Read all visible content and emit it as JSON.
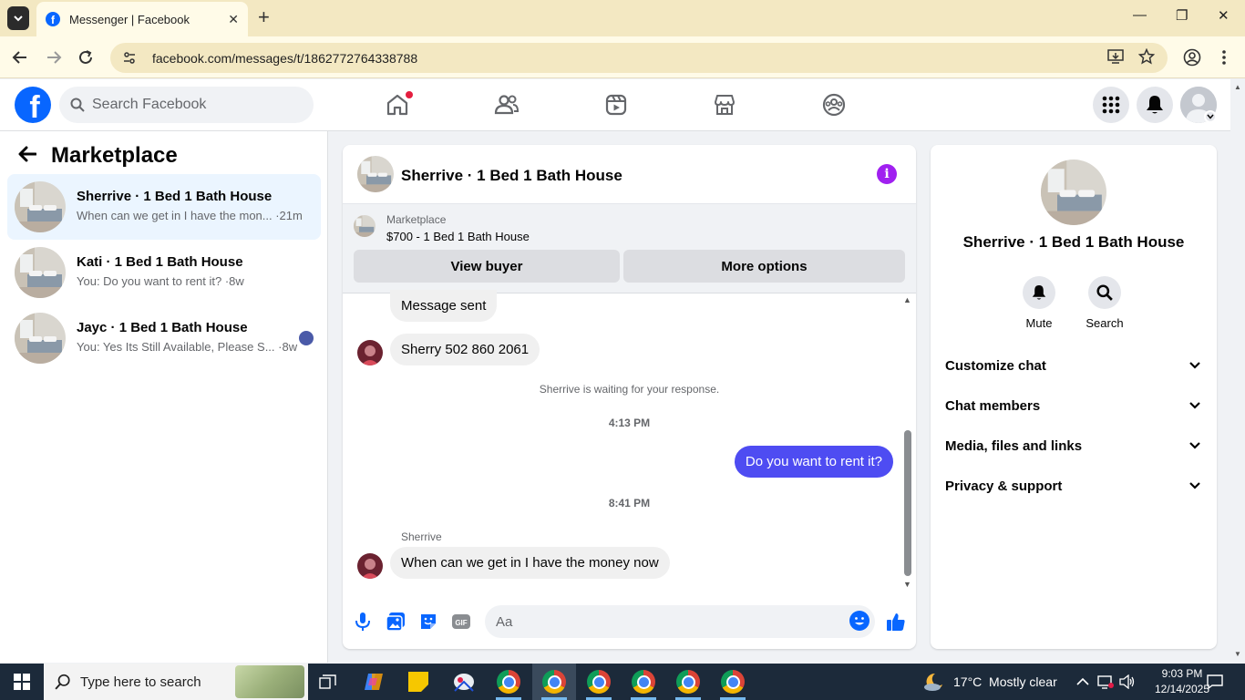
{
  "browser": {
    "tab_title": "Messenger | Facebook",
    "url": "facebook.com/messages/t/1862772764338788",
    "tab_close": "✕",
    "new_tab": "+",
    "window_controls": {
      "minimize": "—",
      "restore": "❐",
      "close": "✕"
    }
  },
  "fb_header": {
    "logo_letter": "f",
    "search_placeholder": "Search Facebook",
    "nav_icons": [
      "home-icon",
      "friends-icon",
      "video-icon",
      "marketplace-icon",
      "groups-icon"
    ],
    "home_notification": true
  },
  "sidebar": {
    "title": "Marketplace",
    "conversations": [
      {
        "name": "Sherrive · 1 Bed 1 Bath House",
        "preview": "When can we get in I have the mon... ·21m",
        "active": true
      },
      {
        "name": "Kati · 1 Bed 1 Bath House",
        "preview": "You: Do you want to rent it? ·8w",
        "active": false
      },
      {
        "name": "Jayc · 1 Bed 1 Bath House",
        "preview": "You: Yes Its Still Available, Please S... ·8w",
        "active": false
      }
    ]
  },
  "chat": {
    "title": "Sherrive · 1 Bed 1 Bath House",
    "marketplace_label": "Marketplace",
    "listing": "$700 - 1 Bed 1 Bath House",
    "view_buyer": "View buyer",
    "more_options": "More options",
    "messages": {
      "m1": "Message sent",
      "m2": "Sherry 502 860 2061",
      "waiting": "Sherrive is waiting for your response.",
      "time1": "4:13 PM",
      "out1": "Do you want to rent it?",
      "time2": "8:41 PM",
      "sender": "Sherrive",
      "m3": "When can we get in I have the money now"
    },
    "composer_placeholder": "Aa",
    "composer_gif": "GIF"
  },
  "info_panel": {
    "name": "Sherrive · 1 Bed 1 Bath House",
    "mute": "Mute",
    "search": "Search",
    "rows": [
      "Customize chat",
      "Chat members",
      "Media, files and links",
      "Privacy & support"
    ]
  },
  "taskbar": {
    "search_placeholder": "Type here to search",
    "weather": "17°C  Mostly clear",
    "time": "9:03 PM",
    "date": "12/14/2025"
  },
  "colors": {
    "fb_blue": "#0866ff",
    "outgoing_bubble": "#4e4cf2",
    "info_purple": "#a020f0",
    "active_conv_bg": "#ebf5ff",
    "browser_frame": "#f3e8c2",
    "taskbar": "#1c2a3a"
  }
}
